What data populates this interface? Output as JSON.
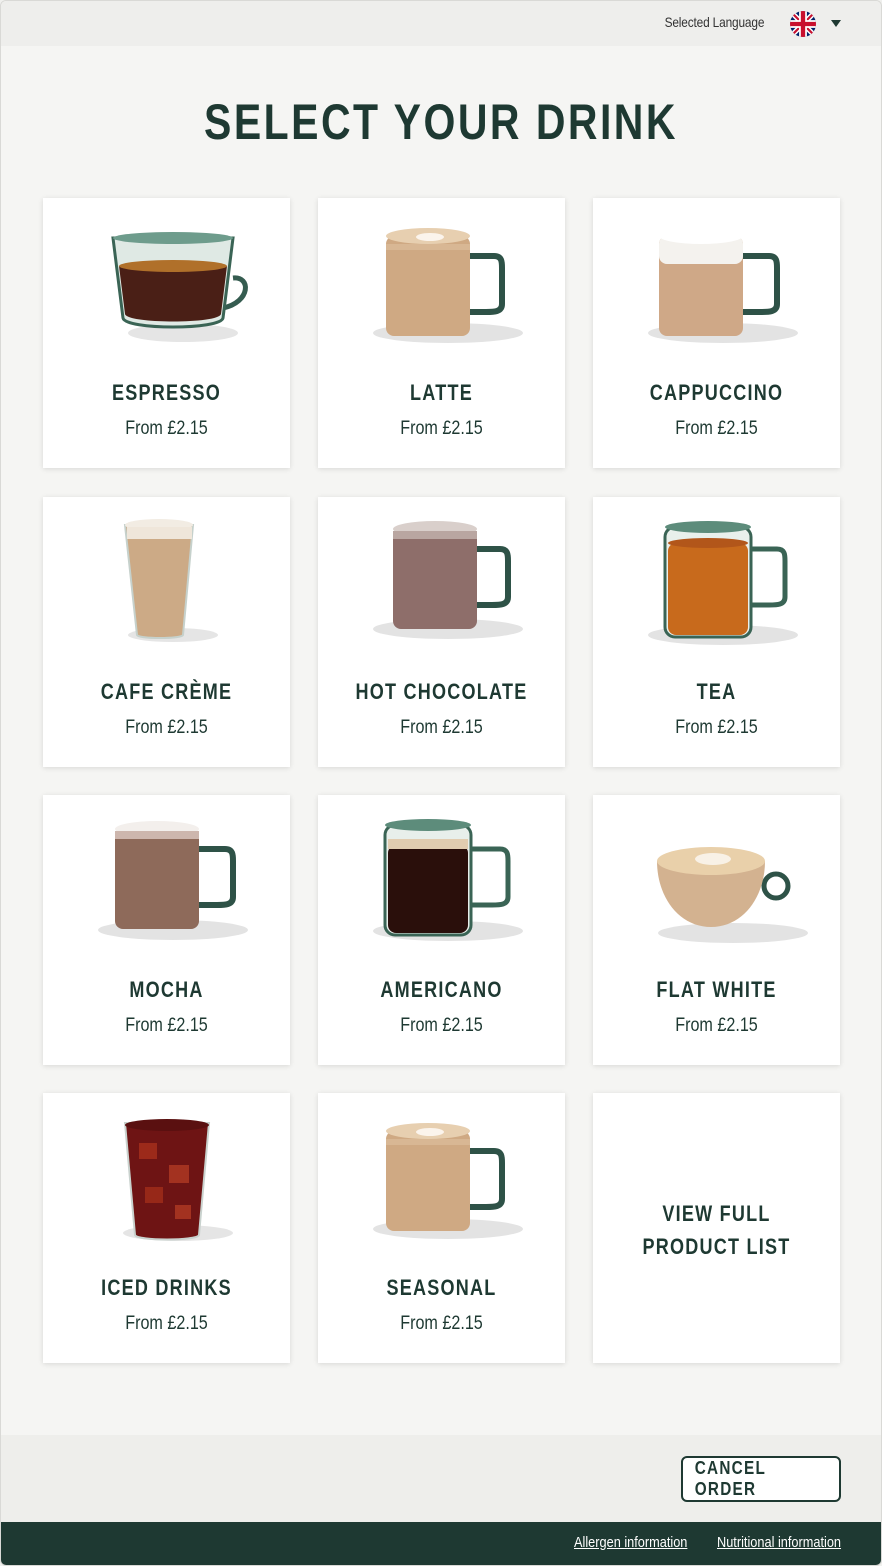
{
  "header": {
    "language_label": "Selected Language",
    "language_flag": "uk-flag-icon"
  },
  "title": "SELECT YOUR DRINK",
  "products": [
    {
      "name": "ESPRESSO",
      "price": "From £2.15",
      "icon": "espresso-glass-cup"
    },
    {
      "name": "LATTE",
      "price": "From £2.15",
      "icon": "latte-mug"
    },
    {
      "name": "CAPPUCCINO",
      "price": "From £2.15",
      "icon": "cappuccino-mug"
    },
    {
      "name": "CAFE CRÈME",
      "price": "From £2.15",
      "icon": "tall-glass"
    },
    {
      "name": "HOT CHOCOLATE",
      "price": "From £2.15",
      "icon": "hot-chocolate-mug"
    },
    {
      "name": "TEA",
      "price": "From £2.15",
      "icon": "tea-glass-mug"
    },
    {
      "name": "MOCHA",
      "price": "From £2.15",
      "icon": "mocha-mug"
    },
    {
      "name": "AMERICANO",
      "price": "From £2.15",
      "icon": "americano-glass-mug"
    },
    {
      "name": "FLAT WHITE",
      "price": "From £2.15",
      "icon": "flat-white-cup"
    },
    {
      "name": "ICED DRINKS",
      "price": "From £2.15",
      "icon": "iced-glass"
    },
    {
      "name": "SEASONAL",
      "price": "From £2.15",
      "icon": "seasonal-mug"
    }
  ],
  "full_list": {
    "line1": "VIEW FULL",
    "line2": "PRODUCT LIST"
  },
  "actions": {
    "cancel_label": "CANCEL ORDER"
  },
  "footer": {
    "allergen_link": "Allergen information",
    "nutrition_link": "Nutritional information"
  },
  "colors": {
    "brand_green": "#1e3932",
    "page_background": "#f5f5f3",
    "card_background": "#ffffff"
  }
}
